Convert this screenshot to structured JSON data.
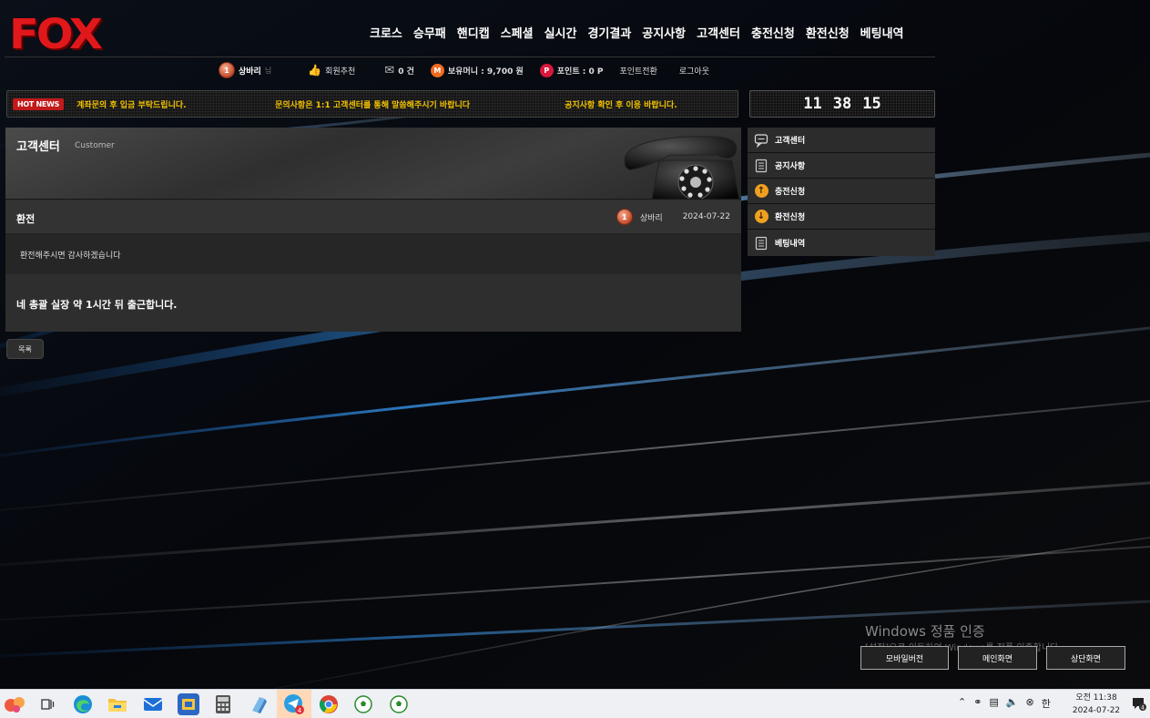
{
  "brand": {
    "logo": "FOX",
    "logo_color": "#e0181b"
  },
  "nav": {
    "items": [
      "크로스",
      "승무패",
      "핸디캡",
      "스페셜",
      "실시간",
      "경기결과",
      "공지사항",
      "고객센터",
      "충전신청",
      "환전신청",
      "베팅내역"
    ]
  },
  "user": {
    "level": "1",
    "name": "상바리",
    "honorific": "님",
    "recommend_label": "회원추천",
    "messages": "0 건",
    "money": "보유머니 : 9,700 원",
    "money_icon": "M",
    "points": "포인트 : 0 P",
    "points_icon": "P",
    "convert_label": "포인트전환",
    "logout_label": "로그아웃"
  },
  "ticker": {
    "badge": "HOT NEWS",
    "items": [
      "계좌문의 후 입금 부탁드립니다.",
      "문의사항은 1:1 고객센터를 통해 말씀해주시기 바랍니다",
      "공지사항 확인 후 이용 바랍니다."
    ],
    "accent": "#f2c200"
  },
  "clock": {
    "h": "11",
    "m": "38",
    "s": "15"
  },
  "panel": {
    "title": "고객센터",
    "subtitle": "Customer",
    "post": {
      "title": "환전",
      "author_level": "1",
      "author": "상바리",
      "date": "2024-07-22",
      "body": "환전해주시면 감사하겠습니다",
      "reply": "네 총괄 실장 약 1시간 뒤 출근합니다."
    },
    "list_button": "목록"
  },
  "side_menu": [
    {
      "label": "고객센터",
      "icon": "chat-icon"
    },
    {
      "label": "공지사항",
      "icon": "notebook-icon"
    },
    {
      "label": "충전신청",
      "icon": "arrow-up-icon"
    },
    {
      "label": "환전신청",
      "icon": "arrow-down-icon"
    },
    {
      "label": "베팅내역",
      "icon": "notebook-icon"
    }
  ],
  "watermark": {
    "title": "Windows 정품 인증",
    "subtitle": "[설정]으로 이동하여 Windows를 정품 인증합니다."
  },
  "bottom_buttons": [
    "모바일버전",
    "메인화면",
    "상단화면"
  ],
  "taskbar": {
    "badge_count": "4",
    "ime": "한",
    "time": "오전 11:38",
    "date": "2024-07-22",
    "notify_count": "4"
  }
}
